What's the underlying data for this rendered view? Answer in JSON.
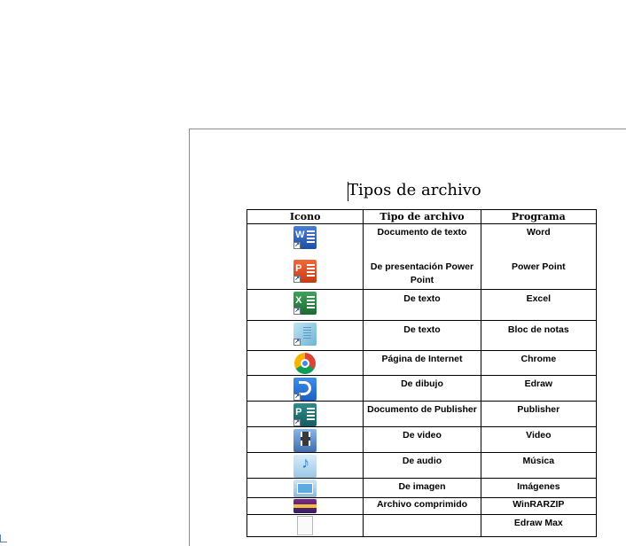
{
  "document": {
    "title": "Tipos de archivo"
  },
  "table": {
    "headers": [
      "Icono",
      "Tipo de archivo",
      "Programa"
    ],
    "rows": [
      {
        "icon": "word-icon",
        "type_lines": [
          "Documento de texto",
          "",
          "De presentación Power Point"
        ],
        "program_lines": [
          "Word",
          "",
          "Power Point"
        ]
      },
      {
        "icon": "excel-icon",
        "type": "De texto",
        "program": "Excel"
      },
      {
        "icon": "notepad-icon",
        "type": "De texto",
        "program": "Bloc de notas"
      },
      {
        "icon": "chrome-icon",
        "type": "Página de Internet",
        "program": "Chrome"
      },
      {
        "icon": "edraw-icon",
        "type": "De dibujo",
        "program": "Edraw"
      },
      {
        "icon": "publisher-icon",
        "type": "Documento de Publisher",
        "program": "Publisher"
      },
      {
        "icon": "video-icon",
        "type": "De video",
        "program": "Video"
      },
      {
        "icon": "audio-icon",
        "type": "De audio",
        "program": "Música"
      },
      {
        "icon": "image-icon",
        "type": "De imagen",
        "program": "Imágenes"
      },
      {
        "icon": "winrar-icon",
        "type": "Archivo comprimido",
        "program": "WinRARZIP"
      },
      {
        "icon": "blank-file-icon",
        "type": "",
        "program": "Edraw Max"
      }
    ],
    "row1_type_a": "Documento de texto",
    "row1_type_b": "De presentación Power Point",
    "row1_program_a": "Word",
    "row1_program_b": "Power Point"
  }
}
